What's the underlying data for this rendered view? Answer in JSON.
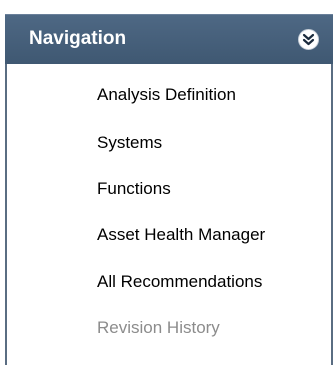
{
  "navigation": {
    "title": "Navigation",
    "collapse_icon": "double-chevron-down-icon",
    "items": [
      {
        "label": "Analysis Definition",
        "enabled": true
      },
      {
        "label": "Systems",
        "enabled": true
      },
      {
        "label": "Functions",
        "enabled": true
      },
      {
        "label": "Asset Health Manager",
        "enabled": true
      },
      {
        "label": "All Recommendations",
        "enabled": true
      },
      {
        "label": "Revision History",
        "enabled": false
      }
    ]
  },
  "colors": {
    "header_bg": "#46607b",
    "border": "#5a6d82",
    "item_text": "#000000",
    "disabled_text": "#8c8c8c"
  }
}
